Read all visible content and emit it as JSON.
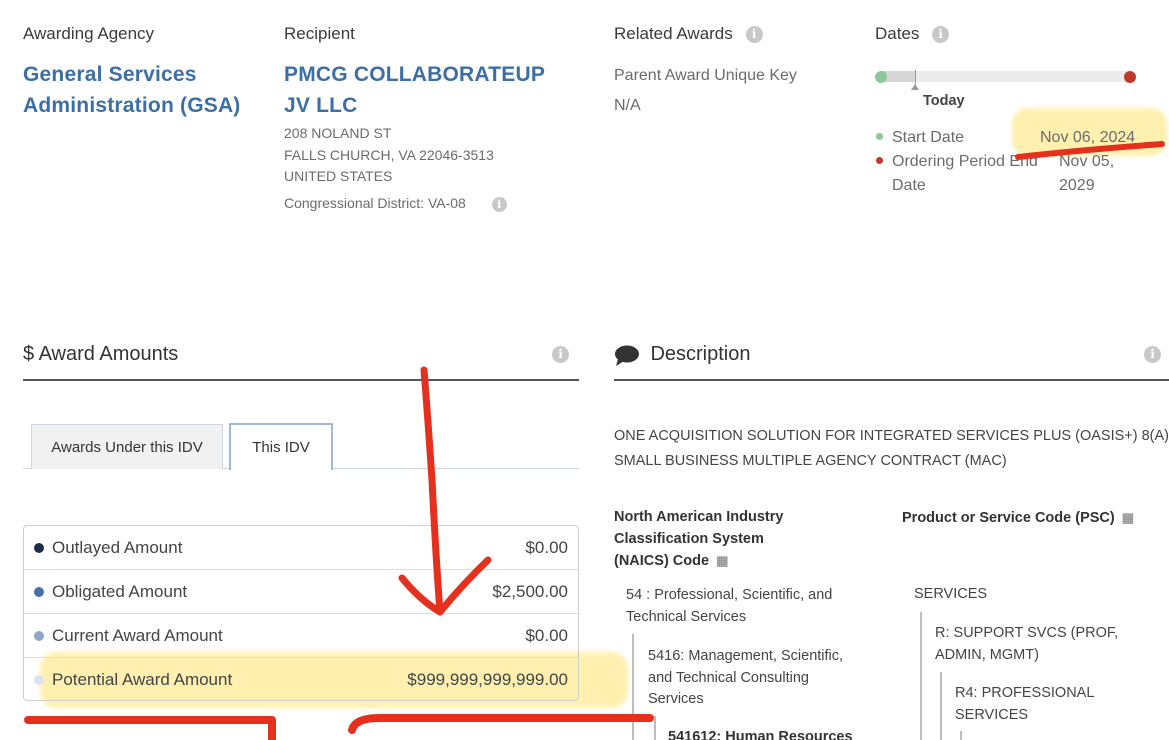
{
  "awarding_agency": {
    "heading": "Awarding Agency",
    "name_line1": "General Services",
    "name_line2": "Administration (GSA)"
  },
  "recipient": {
    "heading": "Recipient",
    "name_line1": "PMCG COLLABORATEUP",
    "name_line2": "JV LLC",
    "address_line1": "208 NOLAND ST",
    "address_line2": "FALLS CHURCH, VA 22046-3513",
    "address_line3": "UNITED STATES",
    "district": "Congressional District: VA-08"
  },
  "related_awards": {
    "heading": "Related Awards",
    "parent_label": "Parent Award Unique Key",
    "parent_value": "N/A"
  },
  "dates": {
    "heading": "Dates",
    "today_label": "Today",
    "start_label": "Start Date",
    "start_value": "Nov 06, 2024",
    "end_label_line1": "Ordering Period End",
    "end_label_line2": "Date",
    "end_value_line1": "Nov 05,",
    "end_value_line2": "2029",
    "start_color": "#8cc79a",
    "end_color": "#c0392b"
  },
  "award_amounts": {
    "heading": "$ Award Amounts",
    "tabs": [
      {
        "label": "Awards Under this IDV"
      },
      {
        "label": "This IDV"
      }
    ],
    "rows": [
      {
        "label": "Outlayed Amount",
        "value": "$0.00",
        "color": "#1e2a4a"
      },
      {
        "label": "Obligated Amount",
        "value": "$2,500.00",
        "color": "#4a6fa5"
      },
      {
        "label": "Current Award Amount",
        "value": "$0.00",
        "color": "#8fa6c6"
      },
      {
        "label": "Potential Award Amount",
        "value": "$999,999,999,999.00",
        "color": "#dde4ef"
      }
    ]
  },
  "description": {
    "heading": "Description",
    "text_line1": "ONE ACQUISITION SOLUTION FOR INTEGRATED SERVICES PLUS (OASIS+) 8(A)",
    "text_line2": "SMALL BUSINESS MULTIPLE AGENCY CONTRACT (MAC)",
    "naics_heading_line1": "North American Industry",
    "naics_heading_line2": "Classification System",
    "naics_heading_line3": "(NAICS)  Code",
    "naics_l1_line1": "54 : Professional, Scientific, and",
    "naics_l1_line2": "Technical Services",
    "naics_l2_line1": "5416: Management, Scientific,",
    "naics_l2_line2": "and Technical Consulting",
    "naics_l2_line3": "Services",
    "naics_l3_line1": "541612: Human Resources",
    "psc_heading": "Product or Service Code  (PSC)",
    "psc_l1": "SERVICES",
    "psc_l2_line1": "R: SUPPORT SVCS (PROF,",
    "psc_l2_line2": "ADMIN, MGMT)",
    "psc_l3_line1": "R4: PROFESSIONAL",
    "psc_l3_line2": "SERVICES"
  }
}
